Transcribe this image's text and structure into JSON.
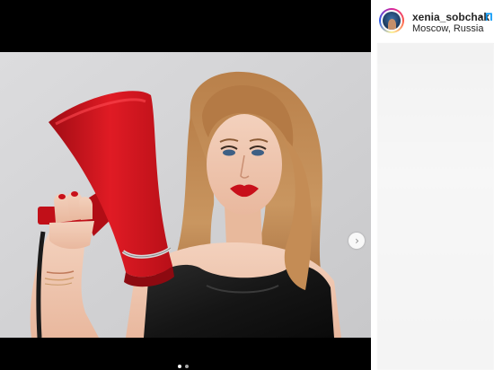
{
  "post": {
    "header": {
      "username": "xenia_sobchak",
      "separator": "•",
      "follow_label": "П",
      "location": "Moscow, Russia"
    },
    "photo": {
      "alt": "Woman in black top holding a red megaphone"
    },
    "carousel": {
      "next_icon": "›",
      "slide_count": 2,
      "active_index": 0
    }
  },
  "colors": {
    "accent_blue": "#0095f6",
    "megaphone_red": "#c8101a",
    "backdrop_gray": "#d2d2d4"
  }
}
